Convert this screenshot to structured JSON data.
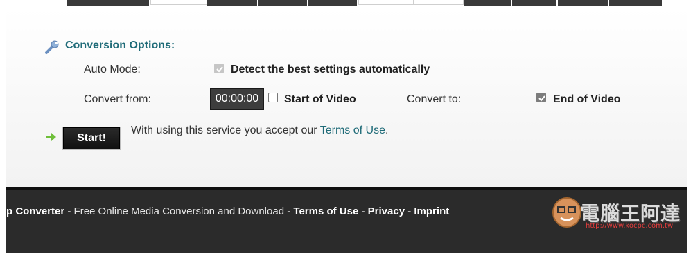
{
  "section": {
    "title": "Conversion Options:"
  },
  "auto_mode": {
    "label": "Auto Mode:",
    "checkbox_label": "Detect the best settings automatically",
    "checked": true,
    "disabled": true
  },
  "convert_from": {
    "label": "Convert from:",
    "time_value": "00:00:00",
    "checkbox_label": "Start of Video",
    "checked": false
  },
  "convert_to": {
    "label": "Convert to:",
    "checkbox_label": "End of Video",
    "checked": true
  },
  "start": {
    "button_label": "Start!",
    "notice_prefix": "With using this service you accept our",
    "terms_link": "Terms of Use",
    "notice_suffix": "."
  },
  "footer": {
    "brand": "p Converter",
    "sep1": " - ",
    "tagline": "Free Online Media Conversion and Download",
    "sep2": " - ",
    "terms": "Terms of Use",
    "sep3": " - ",
    "privacy": "Privacy",
    "sep4": " - ",
    "imprint": "Imprint"
  },
  "watermark": {
    "text": "電腦王阿達",
    "url": "http://www.kocpc.com.tw"
  },
  "colors": {
    "accent": "#1f6b78",
    "footer_bg": "#2b2b2b",
    "button_bg": "#1a1a1a"
  },
  "icons": {
    "section": "wrench-icon",
    "start": "arrow-right-icon"
  }
}
